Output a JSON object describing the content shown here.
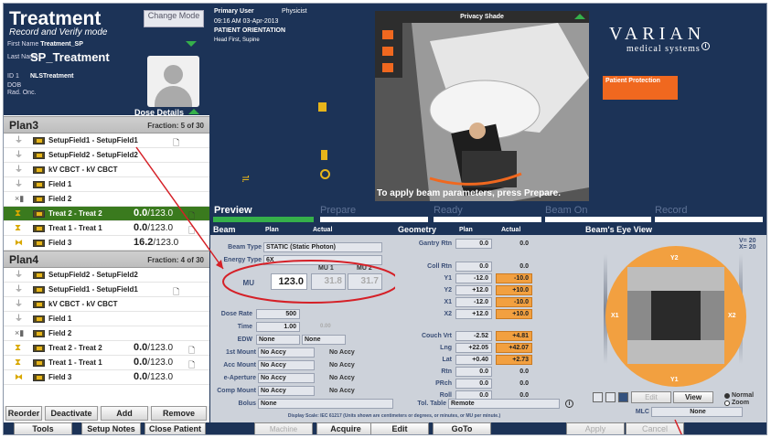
{
  "app": {
    "title": "Treatment",
    "subtitle": "Record and Verify mode",
    "change_mode": "Change Mode"
  },
  "patient": {
    "first_name_label": "First Name",
    "first_name": "Treatment_SP",
    "last_name_label": "Last Name",
    "last_name": "SP_Treatment",
    "id_label": "ID 1",
    "id_value": "NLSTreatment",
    "dob_label": "DOB",
    "rad_onc_label": "Rad. Onc."
  },
  "dose_details_label": "Dose Details",
  "plans": [
    {
      "name": "Plan3",
      "fraction": "Fraction: 5 of 30",
      "fields": [
        {
          "name": "SetupField1 - SetupField1",
          "dose": "",
          "total": "",
          "doc": true
        },
        {
          "name": "SetupField2 - SetupField2",
          "dose": "",
          "total": "",
          "doc": false
        },
        {
          "name": "kV CBCT - kV CBCT",
          "dose": "",
          "total": "",
          "doc": false
        },
        {
          "name": "Field 1",
          "dose": "",
          "total": "",
          "doc": false
        },
        {
          "name": "Field 2",
          "dose": "",
          "total": "",
          "doc": false
        },
        {
          "name": "Treat 2 - Treat 2",
          "dose": "0.0",
          "total": "/123.0",
          "doc": true,
          "active": true
        },
        {
          "name": "Treat 1 - Treat 1",
          "dose": "0.0",
          "total": "/123.0",
          "doc": true
        },
        {
          "name": "Field 3",
          "dose": "16.2",
          "total": "/123.0",
          "doc": false
        }
      ]
    },
    {
      "name": "Plan4",
      "fraction": "Fraction: 4 of 30",
      "fields": [
        {
          "name": "SetupField2 - SetupField2",
          "dose": "",
          "total": "",
          "doc": false
        },
        {
          "name": "SetupField1 - SetupField1",
          "dose": "",
          "total": "",
          "doc": true
        },
        {
          "name": "kV CBCT - kV CBCT",
          "dose": "",
          "total": "",
          "doc": false
        },
        {
          "name": "Field 1",
          "dose": "",
          "total": "",
          "doc": false
        },
        {
          "name": "Field 2",
          "dose": "",
          "total": "",
          "doc": false
        },
        {
          "name": "Treat 2 - Treat 2",
          "dose": "0.0",
          "total": "/123.0",
          "doc": true
        },
        {
          "name": "Treat 1 - Treat 1",
          "dose": "0.0",
          "total": "/123.0",
          "doc": true
        },
        {
          "name": "Field 3",
          "dose": "0.0",
          "total": "/123.0",
          "doc": false
        }
      ]
    }
  ],
  "list_buttons": {
    "reorder": "Reorder",
    "deactivate": "Deactivate",
    "add": "Add",
    "remove": "Remove"
  },
  "toolbar": {
    "tools": "Tools",
    "setup_notes": "Setup Notes",
    "close_patient": "Close Patient",
    "machine_override": "Machine Override",
    "acquire": "Acquire",
    "edit": "Edit",
    "goto": "GoTo",
    "apply": "Apply",
    "cancel": "Cancel"
  },
  "session": {
    "primary_user": "Primary User",
    "role": "Physicist",
    "timestamp": "09:16 AM 03-Apr-2013",
    "orientation_label": "PATIENT ORIENTATION",
    "orientation": "Head First, Supine"
  },
  "camera": {
    "title": "Privacy Shade"
  },
  "apply_message": "To apply beam parameters, press Prepare.",
  "brand": {
    "name": "VARIAN",
    "tagline": "medical systems"
  },
  "patient_protection": "Patient Protection",
  "workflow": {
    "preview": "Preview",
    "prepare": "Prepare",
    "ready": "Ready",
    "beam_on": "Beam On",
    "record": "Record"
  },
  "beam": {
    "header": "Beam",
    "col_plan": "Plan",
    "col_actual": "Actual",
    "beam_type_label": "Beam Type",
    "beam_type": "STATIC (Static Photon)",
    "energy_type_label": "Energy Type",
    "energy_type": "6X",
    "mu_label": "MU",
    "mu1_label": "MU 1",
    "mu2_label": "MU 2",
    "mu_plan": "123.0",
    "mu1": "31.8",
    "mu2": "31.7",
    "dose_rate_label": "Dose Rate",
    "dose_rate": "500",
    "time_label": "Time",
    "time": "1.00",
    "time_actual": "0.00",
    "edw_label": "EDW",
    "edw_plan": "None",
    "edw_actual": "None",
    "mount1_label": "1st Mount",
    "mount1": "No Accy",
    "mount1_actual": "No Accy",
    "acc_mount_label": "Acc Mount",
    "acc_mount": "No Accy",
    "acc_mount_actual": "No Accy",
    "eaperture_label": "e-Aperture",
    "eaperture": "No Accy",
    "eaperture_actual": "No Accy",
    "comp_mount_label": "Comp Mount",
    "comp_mount": "No Accy",
    "comp_mount_actual": "No Accy",
    "bolus_label": "Bolus",
    "bolus": "None"
  },
  "geometry": {
    "header": "Geometry",
    "col_plan": "Plan",
    "col_actual": "Actual",
    "rows": [
      {
        "label": "Gantry Rtn",
        "plan": "0.0",
        "actual": "0.0",
        "hl": false
      },
      {
        "label": "Coll Rtn",
        "plan": "0.0",
        "actual": "0.0",
        "hl": false
      },
      {
        "label": "Y1",
        "plan": "-12.0",
        "actual": "-10.0",
        "hl": true
      },
      {
        "label": "Y2",
        "plan": "+12.0",
        "actual": "+10.0",
        "hl": true
      },
      {
        "label": "X1",
        "plan": "-12.0",
        "actual": "-10.0",
        "hl": true
      },
      {
        "label": "X2",
        "plan": "+12.0",
        "actual": "+10.0",
        "hl": true
      },
      {
        "label": "Couch Vrt",
        "plan": "-2.52",
        "actual": "+4.81",
        "hl": true
      },
      {
        "label": "Lng",
        "plan": "+22.05",
        "actual": "+42.07",
        "hl": true
      },
      {
        "label": "Lat",
        "plan": "+0.40",
        "actual": "+2.73",
        "hl": true
      },
      {
        "label": "Rtn",
        "plan": "0.0",
        "actual": "0.0",
        "hl": false
      },
      {
        "label": "PRch",
        "plan": "0.0",
        "actual": "0.0",
        "hl": false
      },
      {
        "label": "Roll",
        "plan": "0.0",
        "actual": "0.0",
        "hl": false
      }
    ],
    "tol_table_label": "Tol. Table",
    "tol_table": "Remote",
    "scale_note": "Display Scale: IEC 61217 (Units shown are centimeters or degrees, or minutes, or MU per minute.)"
  },
  "bev": {
    "header": "Beam's Eye View",
    "v_readout": "V= 20",
    "x_readout": "X= 20",
    "y2": "Y2",
    "y1": "Y1",
    "x1": "X1",
    "x2": "X2",
    "edit": "Edit",
    "view": "View",
    "normal": "Normal",
    "zoom": "Zoom",
    "mlc_label": "MLC",
    "mlc": "None"
  }
}
